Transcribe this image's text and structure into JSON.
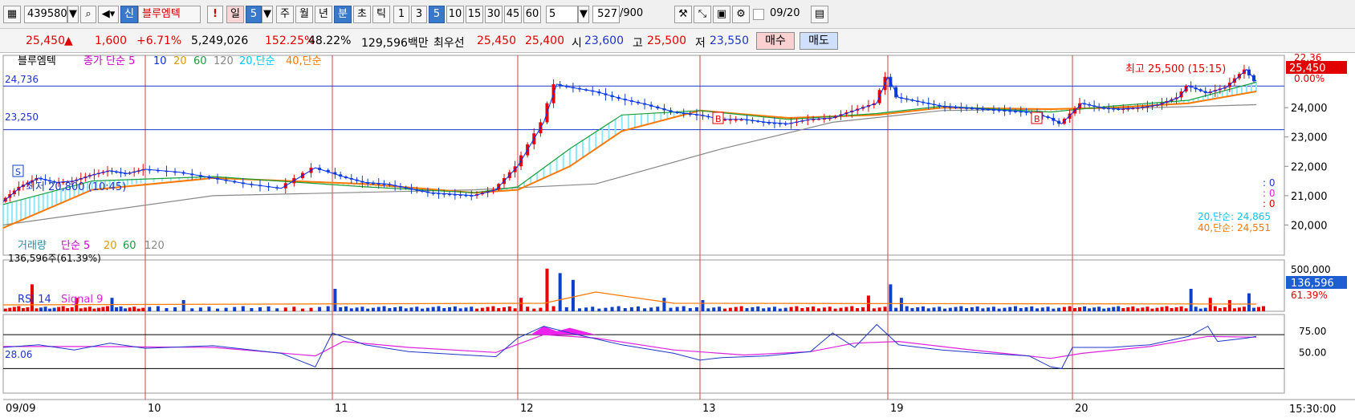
{
  "toolbar": {
    "code": "439580",
    "name_prefix": "신",
    "stock_name": "블루엠텍",
    "bang": "!",
    "period_buttons": [
      "일",
      "5",
      "주",
      "월",
      "년",
      "분",
      "초",
      "틱"
    ],
    "minute_buttons": [
      "1",
      "3",
      "5",
      "10",
      "15",
      "30",
      "45",
      "60"
    ],
    "count_select": "5",
    "bar_count": "527",
    "bar_total": "/900",
    "date": "09/20"
  },
  "quote": {
    "price": "25,450",
    "change_arrow": "▲",
    "change": "1,600",
    "change_pct": "+6.71%",
    "volume": "5,249,026",
    "volume_ratio": "152.25%",
    "turnover": "48.22%",
    "amount": "129,596백만",
    "best_label": "최우선",
    "best_ask": "25,450",
    "best_bid": "25,400",
    "open_label": "시",
    "open": "23,600",
    "high_label": "고",
    "high": "25,500",
    "low_label": "저",
    "low": "23,550",
    "buy_label": "매수",
    "sell_label": "매도"
  },
  "chart_data": [
    {
      "type": "line",
      "title": "블루엠텍",
      "legend": [
        "종가 단순 5",
        "10",
        "20",
        "60",
        "120",
        "20,단순",
        "40,단순"
      ],
      "y_ticks": [
        24000,
        23000,
        22000,
        21000,
        20000
      ],
      "y_tick_labels": [
        "24,000",
        "23,000",
        "22,000",
        "21,000",
        "20,000"
      ],
      "ylim": [
        19000,
        25700
      ],
      "hlines": [
        {
          "value": 24736,
          "label": "24,736"
        },
        {
          "value": 23250,
          "label": "23,250"
        }
      ],
      "x_day_labels": [
        "09/09",
        "10",
        "11",
        "12",
        "13",
        "19",
        "20"
      ],
      "close_path": [
        [
          0,
          20800
        ],
        [
          2,
          21300
        ],
        [
          4,
          21600
        ],
        [
          6,
          21450
        ],
        [
          8,
          21500
        ],
        [
          10,
          21700
        ],
        [
          12,
          21850
        ],
        [
          14,
          21750
        ],
        [
          16,
          21900
        ],
        [
          18,
          21800
        ],
        [
          20,
          21600
        ],
        [
          22,
          21400
        ],
        [
          24,
          21250
        ],
        [
          26,
          21950
        ],
        [
          28,
          21650
        ],
        [
          30,
          21450
        ],
        [
          32,
          21400
        ],
        [
          34,
          21250
        ],
        [
          36,
          21100
        ],
        [
          38,
          21050
        ],
        [
          40,
          21000
        ],
        [
          42,
          21200
        ],
        [
          44,
          22000
        ],
        [
          46,
          23500
        ],
        [
          47,
          24800
        ],
        [
          48,
          24700
        ],
        [
          50,
          24550
        ],
        [
          52,
          24300
        ],
        [
          54,
          24100
        ],
        [
          56,
          23850
        ],
        [
          58,
          23750
        ],
        [
          60,
          23600
        ],
        [
          62,
          23600
        ],
        [
          64,
          23500
        ],
        [
          66,
          23450
        ],
        [
          68,
          23600
        ],
        [
          70,
          23650
        ],
        [
          72,
          23900
        ],
        [
          74,
          24150
        ],
        [
          75,
          25050
        ],
        [
          76,
          24350
        ],
        [
          78,
          24200
        ],
        [
          80,
          24050
        ],
        [
          82,
          24000
        ],
        [
          84,
          23950
        ],
        [
          86,
          23900
        ],
        [
          88,
          23850
        ],
        [
          90,
          23650
        ],
        [
          91,
          23450
        ],
        [
          93,
          24150
        ],
        [
          95,
          24000
        ],
        [
          97,
          23950
        ],
        [
          99,
          24000
        ],
        [
          101,
          24100
        ],
        [
          103,
          24350
        ],
        [
          104,
          24750
        ],
        [
          106,
          24500
        ],
        [
          108,
          24700
        ],
        [
          110,
          25300
        ],
        [
          111,
          24900
        ]
      ],
      "ma20_path": [
        [
          0,
          20700
        ],
        [
          10,
          21500
        ],
        [
          20,
          21650
        ],
        [
          30,
          21300
        ],
        [
          40,
          21100
        ],
        [
          44,
          21300
        ],
        [
          48,
          22600
        ],
        [
          52,
          23750
        ],
        [
          58,
          23900
        ],
        [
          66,
          23600
        ],
        [
          74,
          23800
        ],
        [
          80,
          24050
        ],
        [
          90,
          23850
        ],
        [
          96,
          24050
        ],
        [
          104,
          24250
        ],
        [
          111,
          24865
        ]
      ],
      "ma40_path": [
        [
          0,
          19900
        ],
        [
          10,
          21200
        ],
        [
          20,
          21600
        ],
        [
          30,
          21400
        ],
        [
          40,
          21100
        ],
        [
          44,
          21200
        ],
        [
          48,
          22000
        ],
        [
          52,
          23200
        ],
        [
          58,
          23900
        ],
        [
          66,
          23650
        ],
        [
          74,
          23750
        ],
        [
          80,
          24000
        ],
        [
          90,
          23950
        ],
        [
          96,
          24000
        ],
        [
          104,
          24150
        ],
        [
          111,
          24551
        ]
      ],
      "ma120_path": [
        [
          0,
          20000
        ],
        [
          20,
          21000
        ],
        [
          40,
          21200
        ],
        [
          50,
          21400
        ],
        [
          60,
          22600
        ],
        [
          70,
          23500
        ],
        [
          80,
          23900
        ],
        [
          90,
          23950
        ],
        [
          100,
          24000
        ],
        [
          111,
          24100
        ]
      ],
      "annotations": [
        {
          "text": "최고 25,500 (15:15)",
          "value": 25500
        },
        {
          "text": "최저 20,800 (10:45)",
          "value": 20800
        },
        {
          "text": "20,단순: 24,865"
        },
        {
          "text": "40,단순: 24,551"
        }
      ],
      "right_badge": "25,450",
      "right_pct": "0.00%",
      "right_time": "22.36",
      "signal_counts": [
        ": 0",
        ": 0",
        ": 0"
      ],
      "markers": [
        "S",
        "B",
        "B"
      ]
    },
    {
      "type": "bar",
      "title": "거래량",
      "legend": [
        "단순 5",
        "20",
        "60",
        "120"
      ],
      "current_label": "136,596주(61.39%)",
      "y_tick_labels": [
        "500,000"
      ],
      "right_badge": "136,596",
      "right_pct": "61.39%",
      "spikes": [
        [
          3,
          0.6
        ],
        [
          8,
          0.3
        ],
        [
          12,
          0.3
        ],
        [
          18,
          0.25
        ],
        [
          27,
          0.5
        ],
        [
          44,
          0.3
        ],
        [
          46,
          0.95
        ],
        [
          47,
          0.85
        ],
        [
          48,
          0.7
        ],
        [
          55,
          0.3
        ],
        [
          58,
          0.25
        ],
        [
          73,
          0.35
        ],
        [
          75,
          0.6
        ],
        [
          76,
          0.3
        ],
        [
          104,
          0.5
        ],
        [
          106,
          0.3
        ],
        [
          108,
          0.25
        ],
        [
          110,
          0.4
        ]
      ]
    },
    {
      "type": "line",
      "title": "RSI 14",
      "legend": [
        "RSI 14",
        "Signal 9"
      ],
      "current_label": "28.06",
      "y_ticks": [
        75,
        50
      ],
      "y_tick_labels": [
        "75.00",
        "50.00"
      ],
      "hlines": [
        70,
        30
      ],
      "rsi_path": [
        [
          0,
          55
        ],
        [
          4,
          58
        ],
        [
          8,
          52
        ],
        [
          12,
          60
        ],
        [
          16,
          54
        ],
        [
          20,
          57
        ],
        [
          24,
          48
        ],
        [
          26,
          32
        ],
        [
          27,
          72
        ],
        [
          30,
          58
        ],
        [
          34,
          50
        ],
        [
          38,
          47
        ],
        [
          42,
          44
        ],
        [
          44,
          66
        ],
        [
          46,
          80
        ],
        [
          48,
          72
        ],
        [
          52,
          58
        ],
        [
          56,
          48
        ],
        [
          58,
          40
        ],
        [
          60,
          43
        ],
        [
          64,
          45
        ],
        [
          68,
          50
        ],
        [
          70,
          72
        ],
        [
          72,
          55
        ],
        [
          74,
          82
        ],
        [
          76,
          58
        ],
        [
          80,
          52
        ],
        [
          84,
          48
        ],
        [
          88,
          45
        ],
        [
          90,
          32
        ],
        [
          91,
          30
        ],
        [
          92,
          55
        ],
        [
          96,
          55
        ],
        [
          100,
          58
        ],
        [
          104,
          68
        ],
        [
          106,
          80
        ],
        [
          107,
          62
        ],
        [
          110,
          66
        ],
        [
          111,
          68
        ]
      ],
      "signal_path": [
        [
          0,
          56
        ],
        [
          10,
          56
        ],
        [
          20,
          55
        ],
        [
          26,
          45
        ],
        [
          28,
          62
        ],
        [
          34,
          55
        ],
        [
          42,
          49
        ],
        [
          46,
          70
        ],
        [
          50,
          66
        ],
        [
          56,
          52
        ],
        [
          62,
          46
        ],
        [
          68,
          50
        ],
        [
          72,
          60
        ],
        [
          76,
          62
        ],
        [
          82,
          53
        ],
        [
          90,
          42
        ],
        [
          93,
          48
        ],
        [
          100,
          56
        ],
        [
          106,
          68
        ],
        [
          111,
          67
        ]
      ]
    }
  ],
  "time_axis": {
    "labels": [
      "09/09",
      "10",
      "11",
      "12",
      "13",
      "19",
      "20"
    ],
    "right_time": "15:30:00"
  },
  "colors": {
    "up": "#e60000",
    "down": "#1040c8",
    "ma20": "#00c8ff",
    "ma40": "#ff7800",
    "ma60": "#16a03c",
    "ma120": "#888888",
    "ma5": "#cc00cc",
    "ma10": "#0030ff",
    "signal": "#dd22dd",
    "rsi": "#1d36c8"
  }
}
